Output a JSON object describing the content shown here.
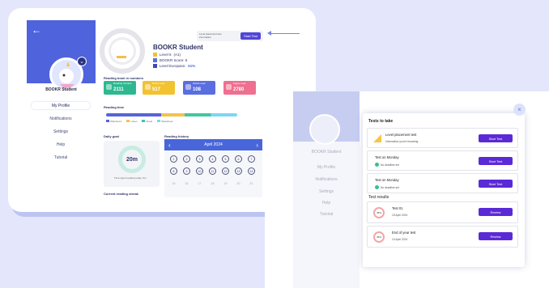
{
  "profile": {
    "back_icon": "arrow-left-icon",
    "user_name": "BOOKR Student",
    "nav": [
      "My Profile",
      "Notifications",
      "Settings",
      "Help",
      "Tutorial"
    ],
    "title": "BOOKR Student",
    "level_label": "Level 6",
    "level_badge": "(A1)",
    "score_label": "BOOKR Score: 5",
    "level_europass_label": "Level Europass:",
    "level_europass_value": "61%",
    "test_box_text": "Level placement test information",
    "test_box_button": "Start Test",
    "reading_section": "Reading book in numbers",
    "tiles": [
      {
        "label": "Reading minutes",
        "value": "2111",
        "color": "#2fb890"
      },
      {
        "label": "Books read",
        "value": "517",
        "color": "#f2c230"
      },
      {
        "label": "Words read",
        "value": "108",
        "color": "#5a6ee0"
      },
      {
        "label": "Pages read",
        "value": "2780",
        "color": "#ef6f90"
      }
    ],
    "reading_time_section": "Reading time",
    "legend": [
      "Watched A",
      "Listen",
      "Aloud",
      "Worksheet"
    ],
    "daily_goal_label": "Daily goal",
    "daily_goal_value": "20m",
    "daily_goal_note": "Time spent reading today: 0m",
    "current_streak_label": "Current reading streak",
    "history_label": "Reading history",
    "calendar_month": "April 2024",
    "calendar_days": [
      "1",
      "2",
      "3",
      "4",
      "5",
      "6",
      "7",
      "8",
      "9",
      "10",
      "11",
      "12",
      "13",
      "14",
      "15",
      "16",
      "17",
      "18",
      "19",
      "20",
      "21"
    ]
  },
  "modal": {
    "title": "Tests to take",
    "close_icon": "close-icon",
    "tests": [
      {
        "name": "Level placement test",
        "sub": "Information you're browsing",
        "button": "Start Test"
      },
      {
        "name": "Test on Monday",
        "sub": "No deadline set",
        "button": "Start Test"
      },
      {
        "name": "Test on Monday",
        "sub": "No deadline set",
        "button": "Start Test"
      }
    ],
    "results_title": "Test results",
    "results": [
      {
        "name": "Test 01",
        "date": "15 April 2024",
        "pct": "45%",
        "button": "Review"
      },
      {
        "name": "End of year test",
        "date": "10 April 2024",
        "pct": "45%",
        "button": "Review"
      }
    ]
  },
  "ghost_sidebar": {
    "name": "BOOKR Student",
    "nav": [
      "My Profile",
      "Notifications",
      "Settings",
      "Help",
      "Tutorial"
    ]
  }
}
